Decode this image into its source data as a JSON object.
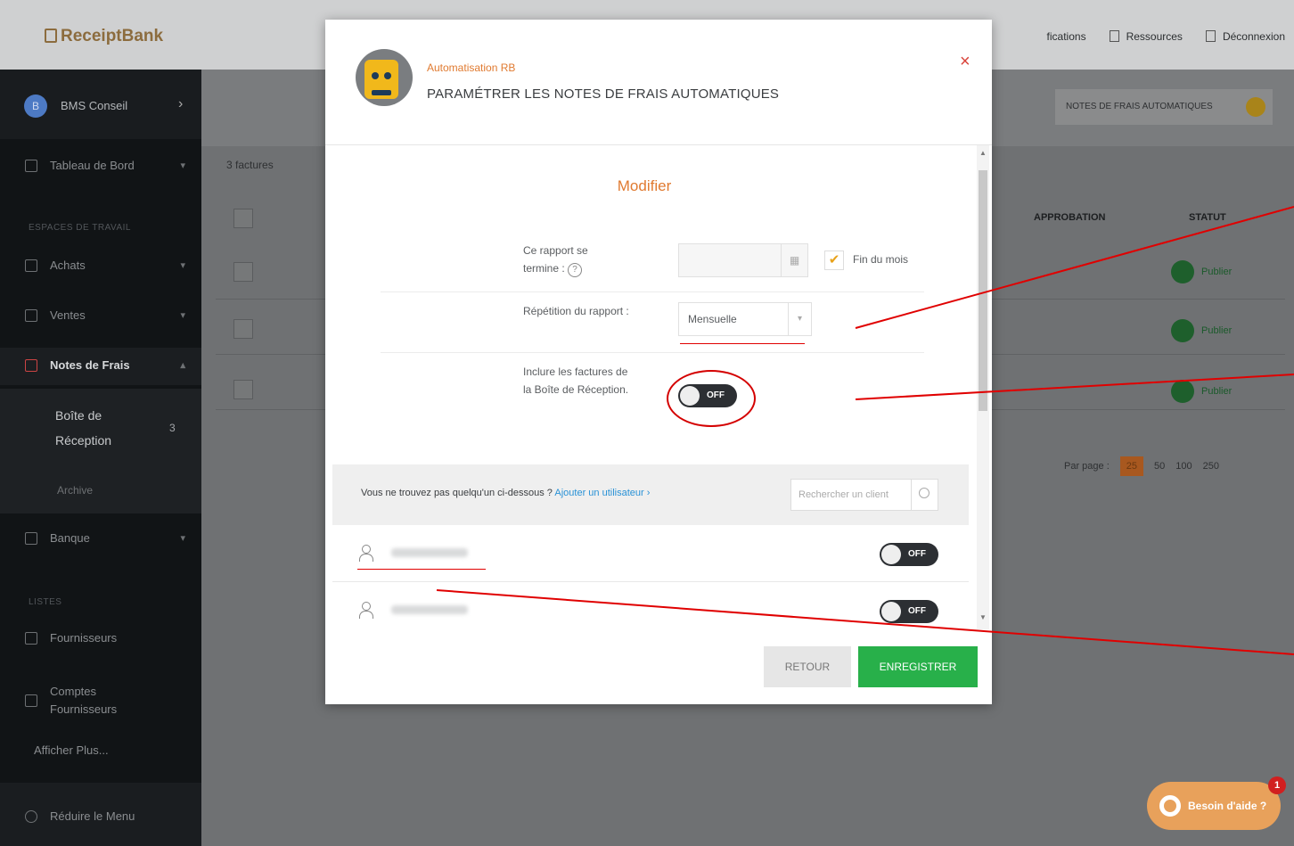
{
  "app": {
    "logo": "ReceiptBank",
    "topnav": [
      "fications",
      "Ressources",
      "Déconnexion"
    ]
  },
  "sidebar": {
    "account": {
      "initial": "B",
      "name": "BMS Conseil"
    },
    "items": [
      {
        "label": "Tableau de Bord"
      },
      {
        "label": "Achats"
      },
      {
        "label": "Ventes"
      },
      {
        "label": "Notes de Frais"
      },
      {
        "label": "Banque"
      },
      {
        "label": "Fournisseurs"
      },
      {
        "label": "Comptes Fournisseurs"
      }
    ],
    "sections": [
      "ESPACES DE TRAVAIL",
      "LISTES"
    ],
    "sub_inbox": "Boîte de Réception",
    "sub_inbox_count": "3",
    "sub_archive": "Archive",
    "show_more": "Afficher Plus...",
    "collapse": "Réduire le Menu"
  },
  "main": {
    "count": "3 factures",
    "auto_button": "NOTES DE FRAIS AUTOMATIQUES",
    "columns": [
      "APPROBATION",
      "STATUT"
    ],
    "status": "Publier",
    "per_page_label": "Par page :",
    "per_page": [
      "25",
      "50",
      "100",
      "250"
    ]
  },
  "help": {
    "label": "Besoin d'aide ?",
    "badge": "1"
  },
  "modal": {
    "subtitle": "Automatisation RB",
    "title": "PARAMÉTRER LES NOTES DE FRAIS AUTOMATIQUES",
    "close": "×",
    "section": "Modifier",
    "end_label": "Ce rapport se termine :",
    "help_mark": "?",
    "end_of_month": "Fin du mois",
    "repeat_label": "Répétition du rapport :",
    "repeat_value": "Mensuelle",
    "include_label": "Inclure les factures de la Boîte de Réception.",
    "toggle_off": "OFF",
    "user_prompt": "Vous ne trouvez pas quelqu'un ci-dessous ?",
    "add_user": "Ajouter un utilisateur",
    "search_placeholder": "Rechercher un client",
    "back": "RETOUR",
    "save": "ENREGISTRER"
  }
}
